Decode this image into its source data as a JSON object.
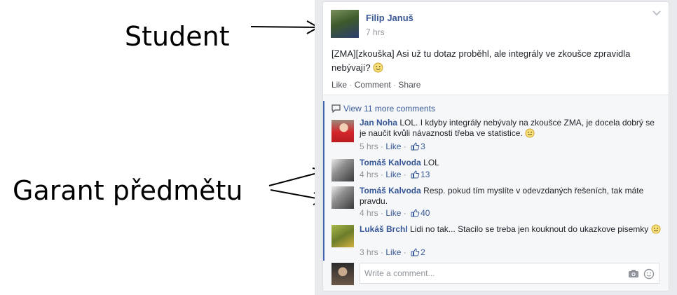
{
  "annotations": {
    "student": "Student",
    "garant": "Garant předmětu"
  },
  "post": {
    "author": "Filip Januš",
    "time": "7 hrs",
    "text": "[ZMA][zkouška] Asi už tu dotaz proběhl, ale integrály ve zkoušce zpravidla nebývají?",
    "actions": {
      "like": "Like",
      "comment": "Comment",
      "share": "Share"
    }
  },
  "view_more": "View 11 more comments",
  "comments": [
    {
      "author": "Jan Noha",
      "text": "LOL. I kdyby integrály nebývaly na zkoušce ZMA, je docela dobrý se je naučit kvůli návaznosti třeba ve statistice.",
      "time": "5 hrs",
      "like": "Like",
      "likes": "3"
    },
    {
      "author": "Tomáš Kalvoda",
      "text": "LOL",
      "time": "4 hrs",
      "like": "Like",
      "likes": "13"
    },
    {
      "author": "Tomáš Kalvoda",
      "text": "Resp. pokud tím myslíte v odevzdaných řešeních, tak máte pravdu.",
      "time": "4 hrs",
      "like": "Like",
      "likes": "40"
    },
    {
      "author": "Lukáš Brchl",
      "text": "Lidi no tak... Stacilo se treba jen kouknout do ukazkove pisemky",
      "time": "3 hrs",
      "like": "Like",
      "likes": "2"
    }
  ],
  "composer": {
    "placeholder": "Write a comment..."
  },
  "colors": {
    "link": "#365899",
    "muted": "#90949c",
    "bar": "#4267b2"
  }
}
